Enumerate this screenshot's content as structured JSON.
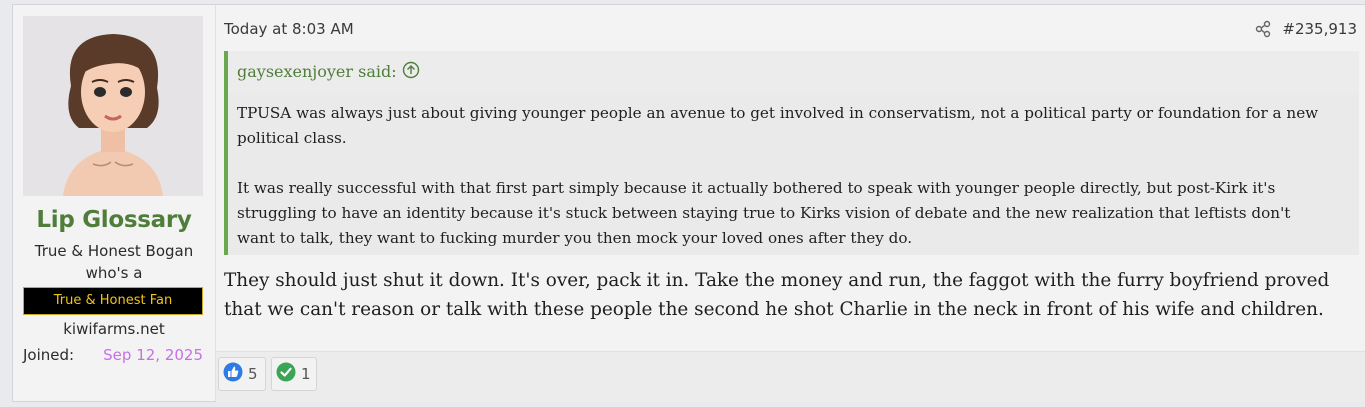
{
  "user": {
    "username": "Lip Glossary",
    "title": "True & Honest Bogan who's a",
    "banner": "True & Honest Fan",
    "site": "kiwifarms.net",
    "joined_label": "Joined:",
    "joined_date": "Sep 12, 2025",
    "avatar_icon": "avatar"
  },
  "post": {
    "date": "Today at 8:03 AM",
    "number": "#235,913",
    "share_icon": "share-icon",
    "quote": {
      "author": "gaysexenjoyer said:",
      "paragraphs": [
        "TPUSA was always just about giving younger people an avenue to get involved in conservatism, not a political party or foundation for a new political class.",
        "It was really successful with that first part simply because it actually bothered to speak with younger people directly, but post-Kirk it's struggling to have an identity because it's stuck between staying true to Kirks vision of debate and the new realization that leftists don't want to talk, they want to fucking murder you then mock your loved ones after they do."
      ]
    },
    "message": "They should just shut it down. It's over, pack it in. Take the money and run, the faggot with the furry boyfriend proved that we can't reason or talk with these people the second he shot Charlie in the neck in front of his wife and children.",
    "reactions": [
      {
        "icon": "thumbs-up-icon",
        "count": "5"
      },
      {
        "icon": "checkmark-icon",
        "count": "1"
      }
    ]
  },
  "colors": {
    "username": "#4f7d3a",
    "quote_border": "#6aa84f",
    "joined_date": "#c86fe8",
    "banner_text": "#f0c419"
  }
}
